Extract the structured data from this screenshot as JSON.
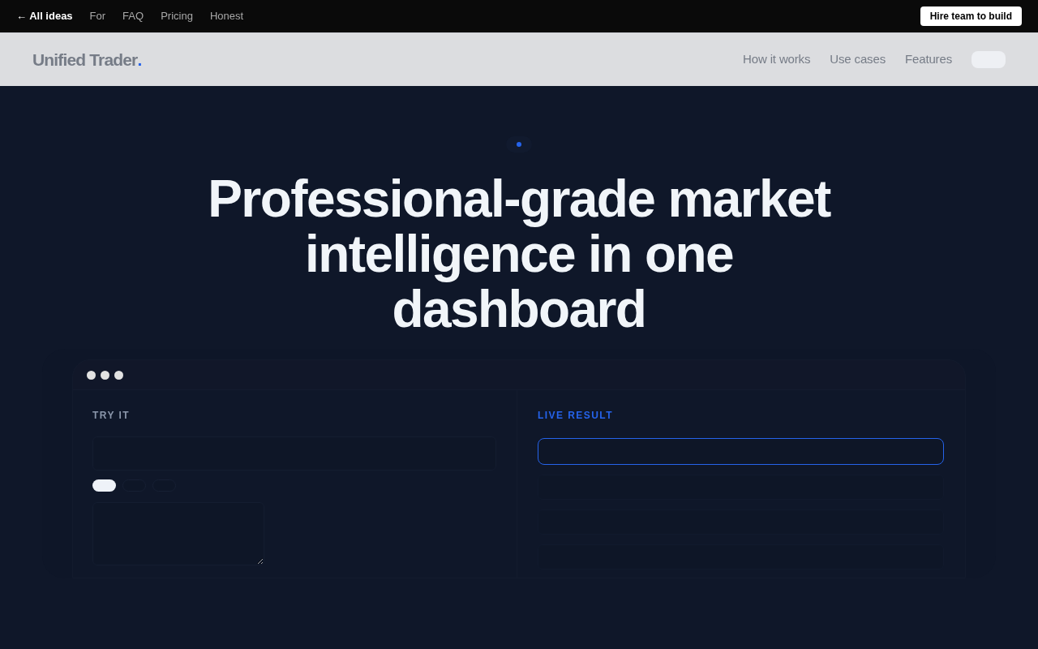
{
  "top_bar": {
    "back_link": "← All ideas",
    "links": [
      "For",
      "FAQ",
      "Pricing",
      "Honest"
    ],
    "cta": "Hire team to build"
  },
  "header": {
    "logo": "Unified Trader",
    "logo_dot": ".",
    "nav": [
      "How it works",
      "Use cases",
      "Features"
    ]
  },
  "hero": {
    "title": "Professional-grade market intelligence in one dashboard"
  },
  "demo": {
    "try_it": {
      "label": "TRY IT",
      "chips": [
        {
          "selected": true
        },
        {
          "selected": false
        },
        {
          "selected": false
        }
      ]
    },
    "live_result": {
      "label": "LIVE RESULT",
      "rows": [
        {
          "selected": true
        },
        {
          "selected": false
        },
        {
          "selected": false
        },
        {
          "selected": false
        }
      ]
    }
  }
}
